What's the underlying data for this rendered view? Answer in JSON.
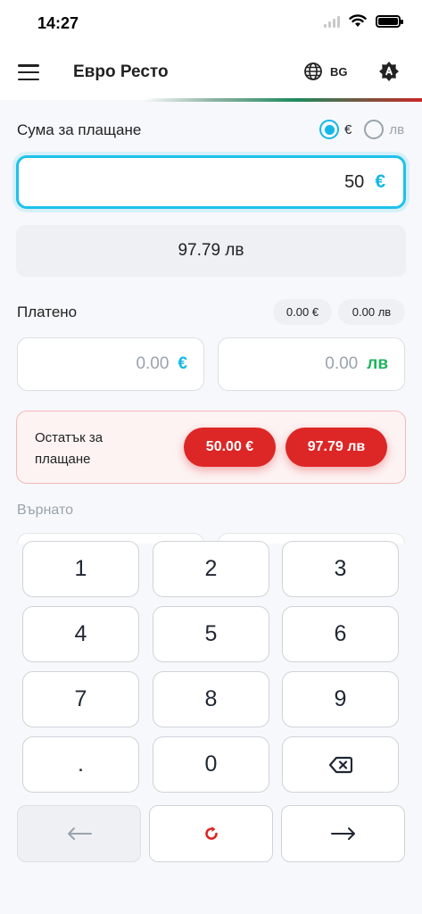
{
  "status_bar": {
    "time": "14:27"
  },
  "app_bar": {
    "title": "Евро Ресто",
    "language_code": "BG"
  },
  "amount_section": {
    "label": "Сума за плащане",
    "currency_options": [
      {
        "label": "€",
        "selected": true
      },
      {
        "label": "лв",
        "selected": false
      }
    ],
    "value": "50",
    "currency_symbol": "€",
    "converted_value": "97.79 лв"
  },
  "paid_section": {
    "label": "Платено",
    "total_eur": "0.00 €",
    "total_bgn": "0.00 лв",
    "eur_input": {
      "value": "0.00",
      "currency": "€"
    },
    "bgn_input": {
      "value": "0.00",
      "currency": "лв"
    }
  },
  "remaining_section": {
    "label": "Остатък за плащане",
    "eur": "50.00 €",
    "bgn": "97.79 лв"
  },
  "returned_section": {
    "label": "Върнато"
  },
  "keypad": {
    "keys": [
      "1",
      "2",
      "3",
      "4",
      "5",
      "6",
      "7",
      "8",
      "9",
      ".",
      "0"
    ],
    "backspace_icon": "backspace-icon",
    "nav": {
      "back_icon": "arrow-left-icon",
      "reset_icon": "reset-icon",
      "forward_icon": "arrow-right-icon"
    }
  },
  "colors": {
    "accent": "#1ec1ec",
    "euro": "#14b8e6",
    "lev": "#1fb35e",
    "danger": "#dd2626"
  }
}
